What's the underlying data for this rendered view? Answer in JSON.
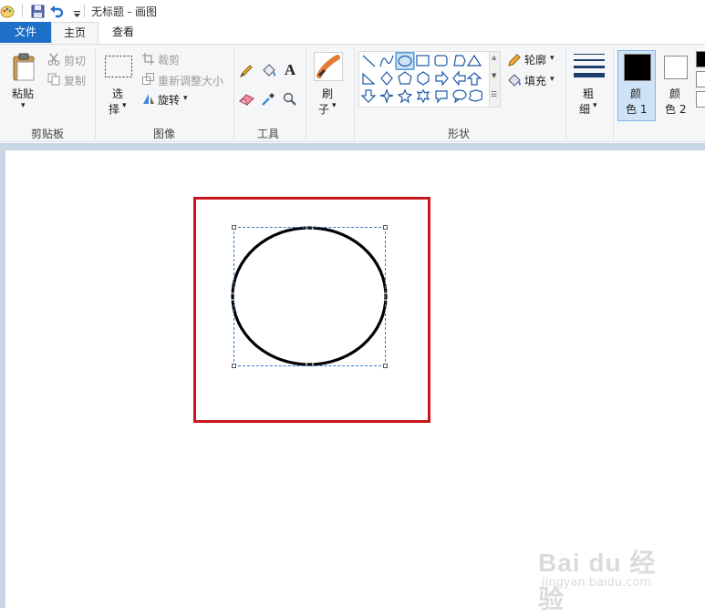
{
  "window": {
    "title": "无标题 - 画图"
  },
  "quick_access": {
    "icons": [
      "paint-app-icon",
      "save-icon",
      "undo-icon",
      "customize-dropdown-icon"
    ]
  },
  "tabs": [
    {
      "label": "文件"
    },
    {
      "label": "主页"
    },
    {
      "label": "查看"
    }
  ],
  "ribbon": {
    "clipboard": {
      "paste_label": "粘贴",
      "cut_label": "剪切",
      "copy_label": "复制",
      "group_label": "剪贴板"
    },
    "image": {
      "select_label_1": "选",
      "select_label_2": "择",
      "crop_label": "裁剪",
      "resize_label": "重新调整大小",
      "rotate_label": "旋转",
      "group_label": "图像"
    },
    "tools": {
      "icons": [
        "pencil-icon",
        "fill-bucket-icon",
        "text-icon",
        "eraser-icon",
        "color-picker-icon",
        "magnifier-icon"
      ],
      "text_glyph": "A",
      "group_label": "工具"
    },
    "brushes": {
      "label_1": "刷",
      "label_2": "子"
    },
    "shapes": {
      "outline_label": "轮廓",
      "fill_label": "填充",
      "group_label": "形状",
      "selected_shape": "oval"
    },
    "size": {
      "label_1": "粗",
      "label_2": "细"
    },
    "colors": {
      "color1_label_1": "颜",
      "color1_label_2": "色 1",
      "color2_label_1": "颜",
      "color2_label_2": "色 2",
      "color1_value": "#000000",
      "color2_value": "#ffffff"
    }
  },
  "canvas": {
    "background": "#ffffff",
    "highlight_color": "#c8161d",
    "selection_color": "#2a7bd0"
  },
  "watermark": {
    "brand": "Bai du 经验",
    "url": "jingyan.baidu.com"
  }
}
